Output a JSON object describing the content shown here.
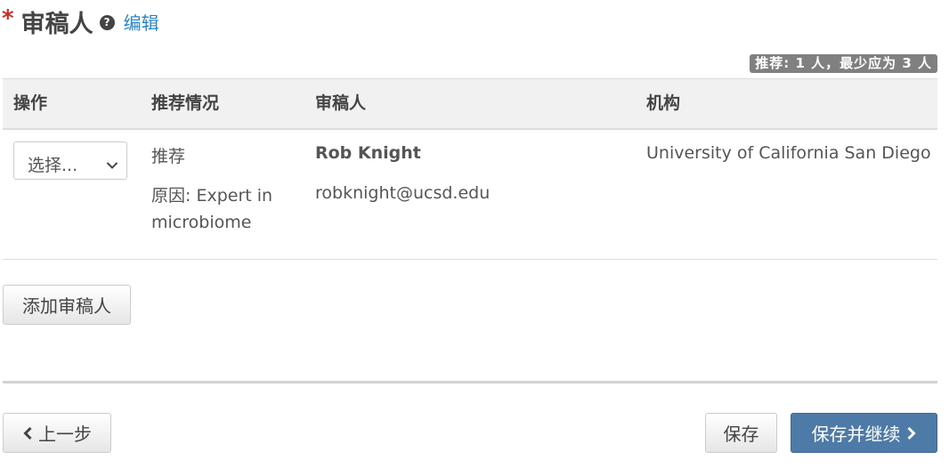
{
  "header": {
    "required_mark": "*",
    "title": "审稿人",
    "help_icon": "?",
    "edit_label": "编辑"
  },
  "badge": {
    "text": "推荐: 1 人，最少应为 3 人"
  },
  "table": {
    "columns": [
      "操作",
      "推荐情况",
      "审稿人",
      "机构"
    ],
    "rows": [
      {
        "action_select": "选择...",
        "recommendation": "推荐",
        "reason": "原因: Expert in microbiome",
        "reviewer_name": "Rob Knight",
        "reviewer_email": "robknight@ucsd.edu",
        "institution": "University of California San Diego"
      }
    ]
  },
  "buttons": {
    "add_reviewer": "添加审稿人",
    "previous": "上一步",
    "save": "保存",
    "save_and_continue": "保存并继续"
  },
  "icons": {
    "help": "question-circle-icon",
    "select_arrow": "chevron-down-icon",
    "previous": "chevron-left-icon",
    "next": "chevron-right-icon"
  },
  "colors": {
    "required": "#c9302c",
    "link": "#2a87c7",
    "primary_button": "#4d7aa6",
    "badge": "#808080"
  }
}
